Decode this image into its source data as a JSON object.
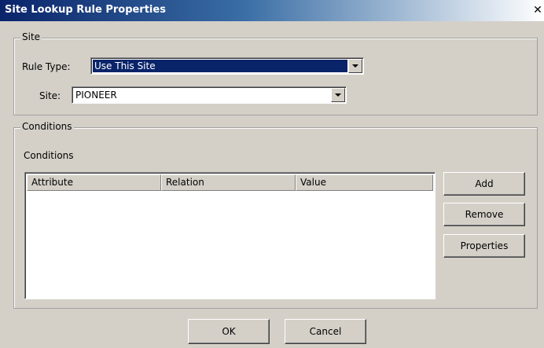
{
  "window": {
    "title": "Site Lookup Rule Properties",
    "close_glyph": "✕"
  },
  "site_group": {
    "legend": "Site",
    "rule_type_label": "Rule Type:",
    "rule_type_value": "Use This Site",
    "site_label": "Site:",
    "site_value": "PIONEER"
  },
  "conditions_group": {
    "legend": "Conditions",
    "list_label": "Conditions",
    "columns": [
      "Attribute",
      "Relation",
      "Value"
    ],
    "rows": [],
    "buttons": {
      "add": "Add",
      "remove": "Remove",
      "properties": "Properties"
    }
  },
  "footer": {
    "ok": "OK",
    "cancel": "Cancel"
  },
  "colors": {
    "dialog_bg": "#d4d0c8",
    "title_gradient_start": "#0a246a",
    "selection": "#0a246a"
  },
  "icons": {
    "close": "close-icon",
    "dropdown": "chevron-down-icon"
  }
}
